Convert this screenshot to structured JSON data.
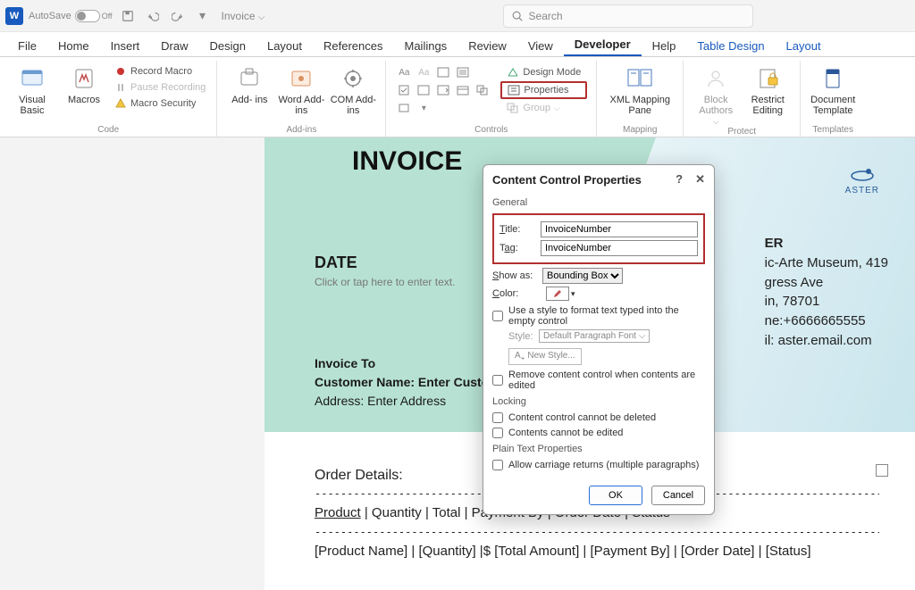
{
  "titlebar": {
    "autosave": "AutoSave",
    "autosave_state": "Off",
    "doc_name": "Invoice",
    "search_placeholder": "Search"
  },
  "tabs": [
    "File",
    "Home",
    "Insert",
    "Draw",
    "Design",
    "Layout",
    "References",
    "Mailings",
    "Review",
    "View",
    "Developer",
    "Help",
    "Table Design",
    "Layout"
  ],
  "active_tab": "Developer",
  "ribbon": {
    "code": {
      "label": "Code",
      "visual_basic": "Visual\nBasic",
      "macros": "Macros",
      "record": "Record Macro",
      "pause": "Pause Recording",
      "security": "Macro Security"
    },
    "addins": {
      "label": "Add-ins",
      "addins": "Add-\nins",
      "word": "Word\nAdd-ins",
      "com": "COM\nAdd-ins"
    },
    "controls": {
      "label": "Controls",
      "design": "Design Mode",
      "properties": "Properties",
      "group": "Group"
    },
    "mapping": {
      "label": "Mapping",
      "pane": "XML Mapping\nPane"
    },
    "protect": {
      "label": "Protect",
      "block": "Block\nAuthors",
      "restrict": "Restrict\nEditing"
    },
    "templates": {
      "label": "Templates",
      "doc": "Document\nTemplate"
    }
  },
  "doc": {
    "title": "INVOICE",
    "company": "ASTER",
    "date_h": "DATE",
    "date_ph": "Click or tap here to enter text.",
    "biz": {
      "name": "ER",
      "addr1": "ic-Arte Museum, 419",
      "addr2": "gress Ave",
      "city": "in, 78701",
      "phone": "ne:+6666665555",
      "email": "il: aster.email.com"
    },
    "invto": {
      "h": "Invoice To",
      "cust_lbl": "Customer Name:",
      "cust_val": "Enter Customer Name",
      "addr_lbl": "Address:",
      "addr_val": "Enter Address"
    },
    "order": {
      "h": "Order Details:",
      "cols": "Product   |  Quantity  | Total  | Payment By | Order Date | Status",
      "vals": "[Product Name] | [Quantity] |$ [Total Amount] | [Payment By] | [Order Date] | [Status]",
      "product_u": "Product"
    }
  },
  "dialog": {
    "title": "Content Control Properties",
    "general": "General",
    "title_lbl": "Title:",
    "title_val": "InvoiceNumber",
    "tag_lbl": "Tag:",
    "tag_val": "InvoiceNumber",
    "showas_lbl": "Show as:",
    "showas_val": "Bounding Box",
    "color_lbl": "Color:",
    "use_style": "Use a style to format text typed into the empty control",
    "style_lbl": "Style:",
    "style_val": "Default Paragraph Font",
    "new_style": "New Style...",
    "remove": "Remove content control when contents are edited",
    "locking": "Locking",
    "lock1": "Content control cannot be deleted",
    "lock2": "Contents cannot be edited",
    "plain": "Plain Text Properties",
    "carriage": "Allow carriage returns (multiple paragraphs)",
    "ok": "OK",
    "cancel": "Cancel"
  }
}
